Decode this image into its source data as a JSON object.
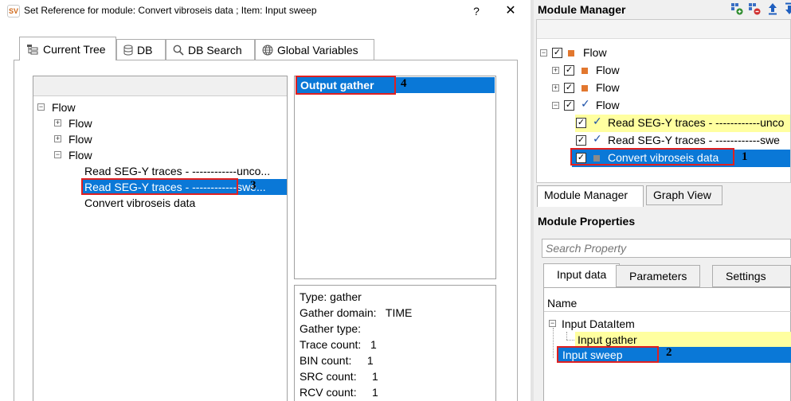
{
  "dialog": {
    "app_icon": "sv-app-icon",
    "title": "Set Reference for module: Convert vibroseis data ; Item: Input sweep",
    "help_label": "?",
    "close_label": "✕",
    "tabs": [
      {
        "label": "Current Tree",
        "icon": "tree-icon"
      },
      {
        "label": "DB",
        "icon": "database-icon"
      },
      {
        "label": "DB Search",
        "icon": "search-icon"
      },
      {
        "label": "Global Variables",
        "icon": "globe-icon"
      }
    ],
    "tree": {
      "root": "Flow",
      "children": [
        "Flow",
        "Flow",
        "Flow"
      ],
      "leaves": [
        "Read SEG-Y traces - ------------unco...",
        "Read SEG-Y traces - ------------swe...",
        "Convert vibroseis data"
      ]
    },
    "output_item": "Output gather",
    "info": {
      "type": "Type: gather",
      "gather_domain": "Gather domain:   TIME",
      "gather_type": "Gather type:",
      "trace_count": "Trace count:   1",
      "bin_count": "BIN count:     1",
      "src_count": "SRC count:     1",
      "rcv_count": "RCV count:     1"
    }
  },
  "module_manager": {
    "title": "Module Manager",
    "toolbar_icons": [
      "add-module-icon",
      "remove-module-icon",
      "move-up-icon",
      "move-down-icon"
    ],
    "tree": {
      "root": "Flow",
      "children": [
        "Flow",
        "Flow",
        "Flow"
      ],
      "leaves": [
        "Read SEG-Y traces - ------------unco",
        "Read SEG-Y traces - ------------swe",
        "Convert vibroseis data"
      ]
    },
    "tabs": [
      "Module Manager",
      "Graph View"
    ],
    "properties_title": "Module Properties",
    "search_placeholder": "Search Property",
    "prop_tabs": [
      "Input data",
      "Parameters",
      "Settings"
    ],
    "prop_header": "Name",
    "prop_items": [
      "Input DataItem",
      "Input gather",
      "Input sweep"
    ]
  },
  "callouts": [
    "1",
    "2",
    "3",
    "4"
  ],
  "colors": {
    "selection": "#0a78d7",
    "highlight_yellow": "#ffffa0",
    "callout": "#e02020",
    "flow_square": "#e2772e"
  }
}
